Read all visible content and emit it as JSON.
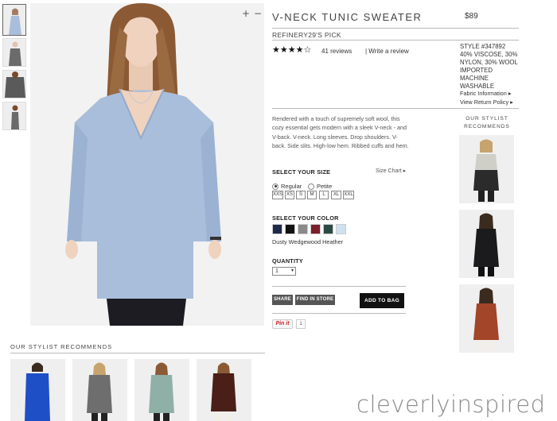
{
  "product": {
    "title": "V-NECK TUNIC SWEATER",
    "price": "$89",
    "badge": "REFINERY29'S PICK",
    "stars": "★★★★☆",
    "reviews": "41 reviews",
    "write_review": "|  Write a review",
    "description": "Rendered with a touch of supremely soft wool, this cozy essential gets modern with a sleek V-neck - and V-back. V-neck. Long sleeves. Drop shoulders. V-back. Side slits. High-low hem. Ribbed cuffs and hem.",
    "colors": {
      "sweater": "#a9bedb",
      "accent_button": "#111111"
    }
  },
  "zoom": {
    "plus": "+",
    "minus": "−"
  },
  "specs": {
    "lines": [
      "STYLE #347892",
      "40% VISCOSE, 30%",
      "NYLON, 30% WOOL",
      "IMPORTED",
      "MACHINE",
      "WASHABLE"
    ],
    "fabric_link": "Fabric Information ▸",
    "return_link": "View Return Policy ▸"
  },
  "size": {
    "label": "SELECT YOUR SIZE",
    "chart_link": "Size Chart ▸",
    "fit_options": [
      "Regular",
      "Petite"
    ],
    "selected_fit": "Regular",
    "sizes": [
      "XXS",
      "XS",
      "S",
      "M",
      "L",
      "XL",
      "XXL"
    ]
  },
  "color": {
    "label": "SELECT YOUR COLOR",
    "swatches": [
      "#1d2a4a",
      "#111111",
      "#8a8a8a",
      "#7a1f2b",
      "#2b4a45",
      "#cfe0ee"
    ],
    "selected_name": "Dusty Wedgewood Heather"
  },
  "quantity": {
    "label": "QUANTITY",
    "value": "1",
    "arrow": "▾"
  },
  "actions": {
    "share": "SHARE",
    "find": "FIND IN STORE",
    "add_to_bag": "ADD TO BAG",
    "pin": "Pin it",
    "pin_count": "1"
  },
  "stylist_side": {
    "title_line1": "OUR STYLIST",
    "title_line2": "RECOMMENDS"
  },
  "stylist_bottom": {
    "title": "OUR STYLIST RECOMMENDS"
  },
  "watermark": "cleverlyinspired"
}
